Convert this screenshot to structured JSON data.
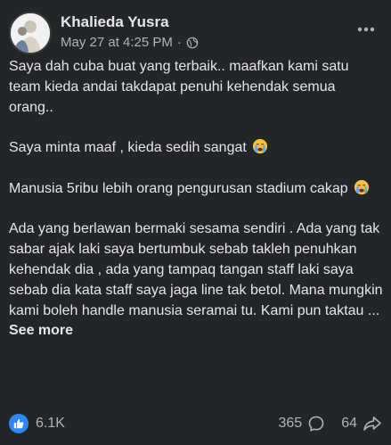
{
  "post": {
    "author": "Khalieda Yusra",
    "timestamp": "May 27 at 4:25 PM",
    "separator": "·",
    "audience_icon": "globe-icon",
    "menu_icon": "more-horizontal-icon",
    "paragraphs": [
      "Saya dah cuba buat yang terbaik.. maafkan kami satu team kieda andai takdapat penuhi kehendak semua orang..",
      "Saya minta maaf , kieda sedih sangat",
      "Manusia 5ribu lebih orang pengurusan stadium cakap",
      "Ada yang berlawan bermaki sesama sendiri . Ada yang tak sabar ajak laki saya bertumbuk sebab takleh penuhkan kehendak dia , ada yang tampaq tangan staff laki saya sebab dia kata staff saya jaga line tak betol. Mana mungkin kami boleh handle manusia seramai tu. Kami pun taktau ..."
    ],
    "emoji_icon": "crying-face-icon",
    "see_more": "See more"
  },
  "footer": {
    "reaction_icon": "like-icon",
    "reaction_count": "6.1K",
    "comment_count": "365",
    "comment_icon": "comment-icon",
    "share_count": "64",
    "share_icon": "share-icon"
  },
  "colors": {
    "background": "#242526",
    "text_primary": "#e4e6eb",
    "text_secondary": "#b0b3b8",
    "like_blue": "#2d88ff"
  }
}
